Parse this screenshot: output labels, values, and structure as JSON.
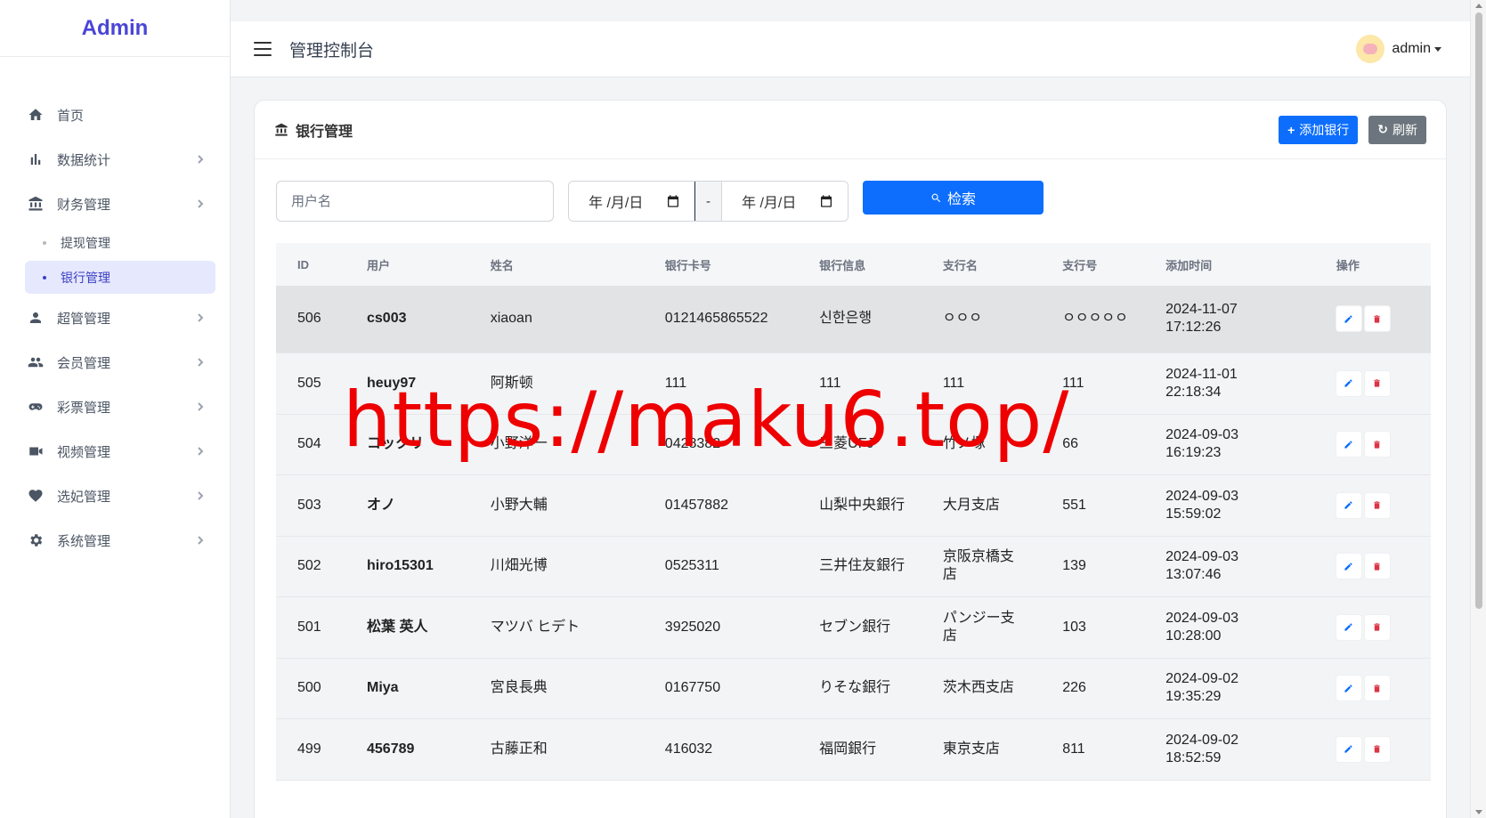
{
  "app": {
    "brand": "Admin",
    "page_title": "管理控制台"
  },
  "user": {
    "name": "admin"
  },
  "sidebar": {
    "items": [
      {
        "label": "首页",
        "icon": "home-icon",
        "expandable": false
      },
      {
        "label": "数据统计",
        "icon": "bar-chart-icon",
        "expandable": true
      },
      {
        "label": "财务管理",
        "icon": "bank-icon",
        "expandable": true
      },
      {
        "label": "超管管理",
        "icon": "person-icon",
        "expandable": true
      },
      {
        "label": "会员管理",
        "icon": "people-icon",
        "expandable": true
      },
      {
        "label": "彩票管理",
        "icon": "gamepad-icon",
        "expandable": true
      },
      {
        "label": "视频管理",
        "icon": "video-icon",
        "expandable": true
      },
      {
        "label": "选妃管理",
        "icon": "heart-icon",
        "expandable": true
      },
      {
        "label": "系统管理",
        "icon": "gear-icon",
        "expandable": true
      }
    ],
    "finance_sub": [
      {
        "label": "提现管理",
        "active": false
      },
      {
        "label": "银行管理",
        "active": true
      }
    ]
  },
  "card": {
    "title": "银行管理",
    "add_button": "添加银行",
    "refresh_button": "刷新"
  },
  "filters": {
    "username_placeholder": "用户名",
    "date_from": "年 /月/日",
    "date_to": "年 /月/日",
    "date_separator": "-",
    "search_button": "检索"
  },
  "table": {
    "headers": [
      "ID",
      "用户",
      "姓名",
      "银行卡号",
      "银行信息",
      "支行名",
      "支行号",
      "添加时间",
      "操作"
    ],
    "rows": [
      {
        "id": "506",
        "user": "cs003",
        "name": "xiaoan",
        "card": "0121465865522",
        "bank": "신한은행",
        "branch": "ㅇㅇㅇ",
        "branch_no": "ㅇㅇㅇㅇㅇ",
        "date": "2024-11-07",
        "time": "17:12:26"
      },
      {
        "id": "505",
        "user": "heuy97",
        "name": "阿斯顿",
        "card": "111",
        "bank": "111",
        "branch": "111",
        "branch_no": "111",
        "date": "2024-11-01",
        "time": "22:18:34"
      },
      {
        "id": "504",
        "user": "コックリ",
        "name": "小野洋一",
        "card": "0428382",
        "bank": "三菱UFJ",
        "branch": "竹ノ塚",
        "branch_no": "66",
        "date": "2024-09-03",
        "time": "16:19:23"
      },
      {
        "id": "503",
        "user": "オノ",
        "name": "小野大輔",
        "card": "01457882",
        "bank": "山梨中央銀行",
        "branch": "大月支店",
        "branch_no": "551",
        "date": "2024-09-03",
        "time": "15:59:02"
      },
      {
        "id": "502",
        "user": "hiro15301",
        "name": "川畑光博",
        "card": "0525311",
        "bank": "三井住友銀行",
        "branch": "京阪京橋支店",
        "branch_no": "139",
        "date": "2024-09-03",
        "time": "13:07:46"
      },
      {
        "id": "501",
        "user": "松葉 英人",
        "name": "マツバ ヒデト",
        "card": "3925020",
        "bank": "セブン銀行",
        "branch": "パンジー支店",
        "branch_no": "103",
        "date": "2024-09-03",
        "time": "10:28:00"
      },
      {
        "id": "500",
        "user": "Miya",
        "name": "宮良長典",
        "card": "0167750",
        "bank": "りそな銀行",
        "branch": "茨木西支店",
        "branch_no": "226",
        "date": "2024-09-02",
        "time": "19:35:29"
      },
      {
        "id": "499",
        "user": "456789",
        "name": "古藤正和",
        "card": "416032",
        "bank": "福岡銀行",
        "branch": "東京支店",
        "branch_no": "811",
        "date": "2024-09-02",
        "time": "18:52:59"
      }
    ]
  },
  "watermark": "https://maku6.top/",
  "colors": {
    "brand": "#4a45d6",
    "primary": "#0d6efd",
    "secondary": "#6c757d",
    "danger": "#dc3545",
    "active_bg": "#e6e8fd",
    "watermark": "#ee0000"
  }
}
